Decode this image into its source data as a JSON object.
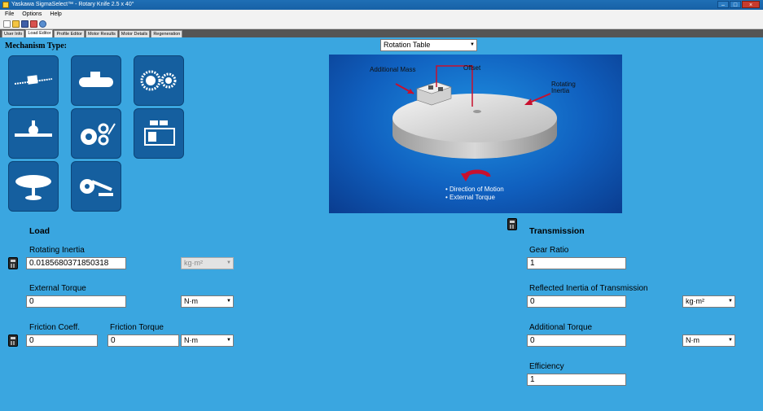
{
  "window": {
    "title": "Yaskawa SigmaSelect™ - Rotary Knife 2.5 x 40°",
    "buttons": {
      "minimize": "–",
      "maximize": "□",
      "close": "×"
    }
  },
  "menu": [
    "File",
    "Options",
    "Help"
  ],
  "toolbar": [
    "new-icon",
    "open-icon",
    "save-icon",
    "print-icon",
    "help-icon"
  ],
  "tabs": [
    "User Info",
    "Load Editor",
    "Profile Editor",
    "Motor Results",
    "Motor Details",
    "Regeneration"
  ],
  "mechanism": {
    "title": "Mechanism Type:",
    "selected": "Rotation Table",
    "buttons": [
      "ball-screw",
      "conveyor-belt",
      "chain-sprocket",
      "rack-pinion",
      "roll-feed",
      "stacker",
      "rotation-table",
      "knife-cutter"
    ]
  },
  "diagram": {
    "additional_mass": "Additional Mass",
    "offset": "Offset",
    "rotating_inertia": "Rotating Inertia",
    "direction_of_motion": "• Direction of Motion",
    "external_torque": "• External Torque"
  },
  "load": {
    "header": "Load",
    "rotating_inertia": {
      "label": "Rotating Inertia",
      "value": "0.0185680371850318",
      "unit": "kg·m²"
    },
    "external_torque": {
      "label": "External Torque",
      "value": "0",
      "unit": "N·m"
    },
    "friction_coeff": {
      "label": "Friction Coeff.",
      "value": "0"
    },
    "friction_torque": {
      "label": "Friction Torque",
      "value": "0",
      "unit": "N·m"
    }
  },
  "transmission": {
    "header": "Transmission",
    "gear_ratio": {
      "label": "Gear Ratio",
      "value": "1"
    },
    "reflected_inertia": {
      "label": "Reflected Inertia of Transmission",
      "value": "0",
      "unit": "kg·m²"
    },
    "additional_torque": {
      "label": "Additional Torque",
      "value": "0",
      "unit": "N·m"
    },
    "efficiency": {
      "label": "Efficiency",
      "value": "1"
    }
  },
  "colors": {
    "background": "#3aa6e0",
    "button": "#155f9f",
    "diagram": "#1060bf"
  }
}
